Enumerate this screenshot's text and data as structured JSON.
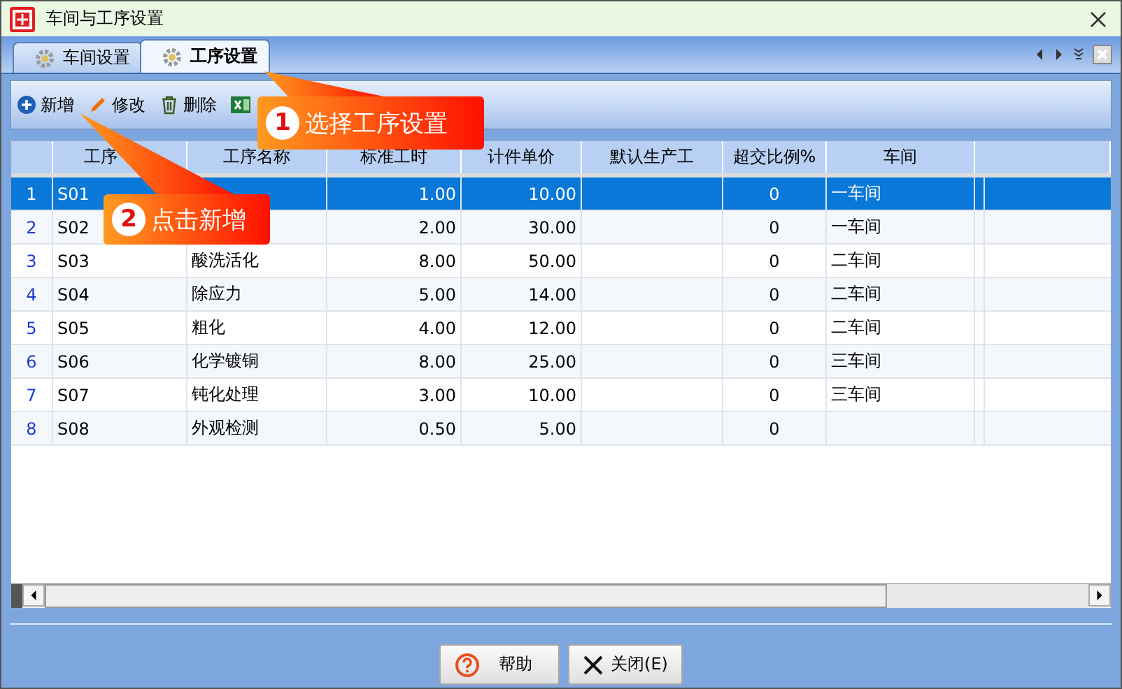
{
  "window": {
    "title": "车间与工序设置"
  },
  "tabs": [
    {
      "label": "车间设置",
      "selected": false
    },
    {
      "label": "工序设置",
      "selected": true
    }
  ],
  "toolbar": [
    {
      "kind": "add",
      "label": "新增"
    },
    {
      "kind": "edit",
      "label": "修改"
    },
    {
      "kind": "delete",
      "label": "删除"
    },
    {
      "kind": "excel"
    }
  ],
  "table": {
    "columns": [
      "工序",
      "工序名称",
      "标准工时",
      "计件单价",
      "默认生产工",
      "超交比例%",
      "车间"
    ],
    "rows": [
      {
        "num": "1",
        "code": "S01",
        "hours": "1.00",
        "price": "10.00",
        "ratio": "0",
        "workshop": "一车间",
        "selected": true
      },
      {
        "num": "2",
        "code": "S02",
        "hours": "2.00",
        "price": "30.00",
        "ratio": "0",
        "workshop": "一车间",
        "selected": false
      },
      {
        "num": "3",
        "code": "S03",
        "name": "酸洗活化",
        "hours": "8.00",
        "price": "50.00",
        "ratio": "0",
        "workshop": "二车间",
        "selected": false
      },
      {
        "num": "4",
        "code": "S04",
        "name": "除应力",
        "hours": "5.00",
        "price": "14.00",
        "ratio": "0",
        "workshop": "二车间",
        "selected": false
      },
      {
        "num": "5",
        "code": "S05",
        "name": "粗化",
        "hours": "4.00",
        "price": "12.00",
        "ratio": "0",
        "workshop": "二车间",
        "selected": false
      },
      {
        "num": "6",
        "code": "S06",
        "name": "化学镀铜",
        "hours": "8.00",
        "price": "25.00",
        "ratio": "0",
        "workshop": "三车间",
        "selected": false
      },
      {
        "num": "7",
        "code": "S07",
        "name": "钝化处理",
        "hours": "3.00",
        "price": "10.00",
        "ratio": "0",
        "workshop": "三车间",
        "selected": false
      },
      {
        "num": "8",
        "code": "S08",
        "name": "外观检测",
        "hours": "0.50",
        "price": "5.00",
        "ratio": "0",
        "selected": false
      }
    ]
  },
  "buttons": [
    {
      "kind": "help",
      "label": "帮助"
    },
    {
      "kind": "close",
      "label": "关闭(E)"
    }
  ],
  "annotations": [
    {
      "number": "1",
      "text": "选择工序设置"
    },
    {
      "number": "2",
      "text": "点击新增"
    }
  ]
}
